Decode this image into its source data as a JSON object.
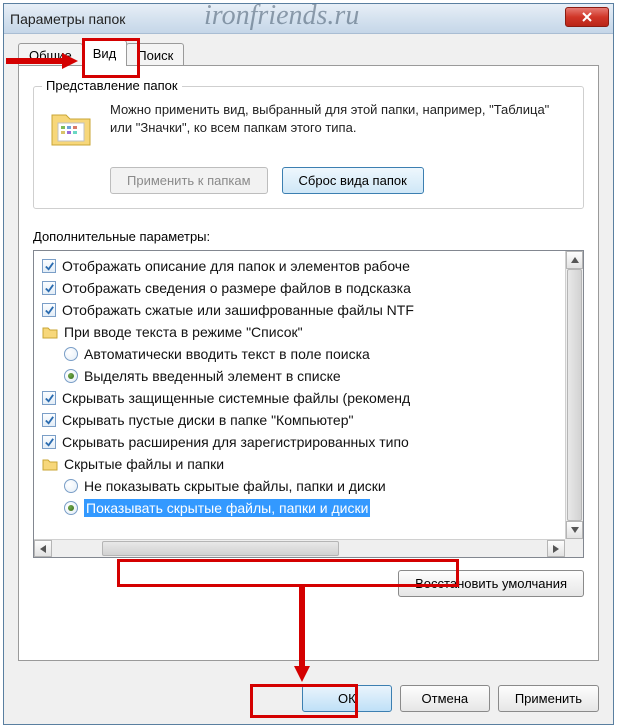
{
  "window": {
    "title": "Параметры папок",
    "watermark": "ironfriends.ru"
  },
  "tabs": {
    "general": "Общие",
    "view": "Вид",
    "search": "Поиск"
  },
  "groupbox": {
    "title": "Представление папок",
    "text": "Можно применить вид, выбранный для этой папки, например, \"Таблица\" или \"Значки\", ко всем папкам этого типа.",
    "apply_btn": "Применить к папкам",
    "reset_btn": "Сброс вида папок"
  },
  "advanced_label": "Дополнительные параметры:",
  "tree": {
    "i0": "Отображать описание для папок и элементов рабоче",
    "i1": "Отображать сведения о размере файлов в подсказка",
    "i2": "Отображать сжатые или зашифрованные файлы NTF",
    "i3": "При вводе текста в режиме \"Список\"",
    "i3a": "Автоматически вводить текст в поле поиска",
    "i3b": "Выделять введенный элемент в списке",
    "i4": "Скрывать защищенные системные файлы (рекоменд",
    "i5": "Скрывать пустые диски в папке \"Компьютер\"",
    "i6": "Скрывать расширения для зарегистрированных типо",
    "i7": "Скрытые файлы и папки",
    "i7a": "Не показывать скрытые файлы, папки и диски",
    "i7b": "Показывать скрытые файлы, папки и диски"
  },
  "restore_btn": "Восстановить умолчания",
  "dialog_buttons": {
    "ok": "ОК",
    "cancel": "Отмена",
    "apply": "Применить"
  }
}
